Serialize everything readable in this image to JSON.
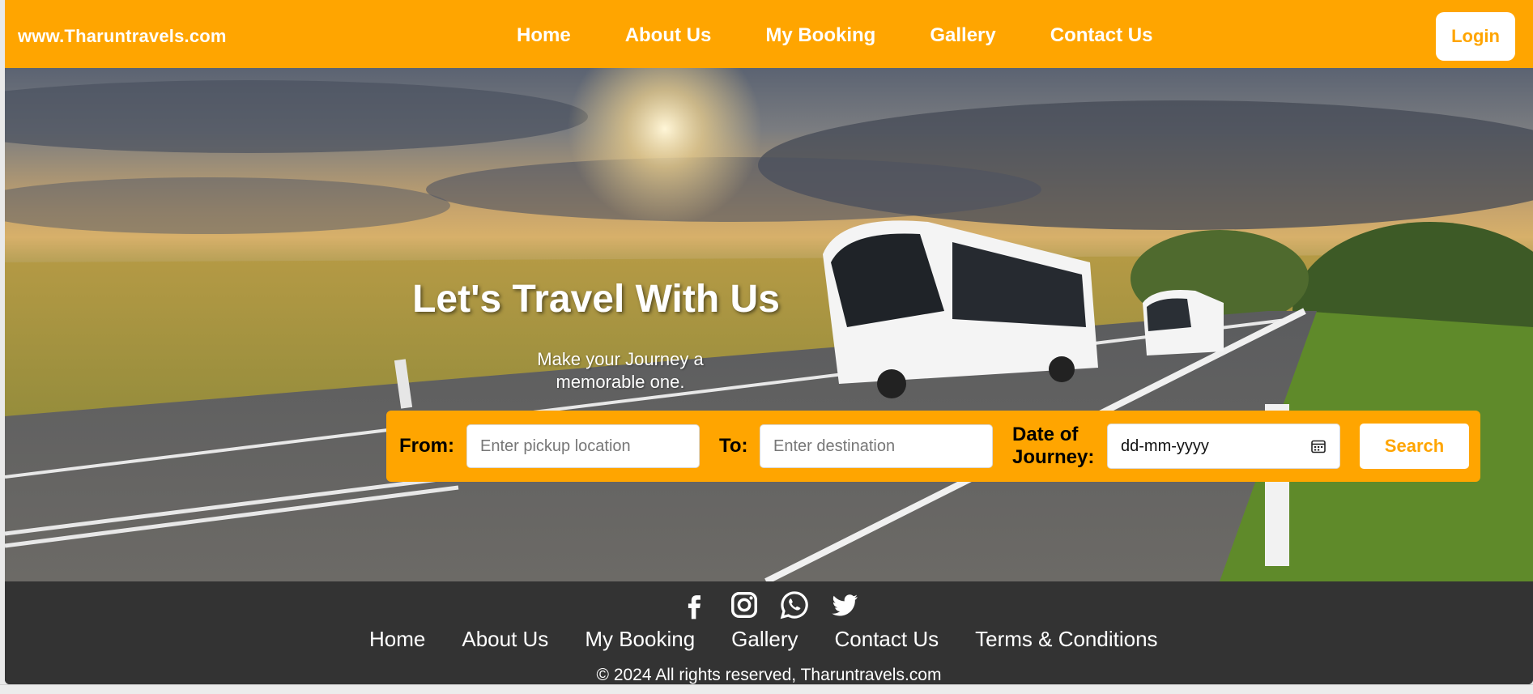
{
  "header": {
    "site_name": "www.Tharuntravels.com",
    "nav": [
      "Home",
      "About Us",
      "My Booking",
      "Gallery",
      "Contact Us"
    ],
    "login_label": "Login"
  },
  "hero": {
    "title": "Let's Travel With Us",
    "subtitle": "Make your Journey a memorable one."
  },
  "search": {
    "from_label": "From:",
    "from_placeholder": "Enter pickup location",
    "to_label": "To:",
    "to_placeholder": "Enter destination",
    "date_label_line1": "Date of",
    "date_label_line2": "Journey:",
    "date_placeholder": "dd-mm-yyyy",
    "button_label": "Search"
  },
  "footer": {
    "social_icons": [
      "facebook-icon",
      "instagram-icon",
      "whatsapp-icon",
      "twitter-icon"
    ],
    "links": [
      "Home",
      "About Us",
      "My Booking",
      "Gallery",
      "Contact Us",
      "Terms & Conditions"
    ],
    "copyright": "© 2024 All rights reserved, Tharuntravels.com"
  },
  "colors": {
    "accent": "#ffa500",
    "footer_bg": "#333333",
    "text_light": "#ffffff"
  }
}
